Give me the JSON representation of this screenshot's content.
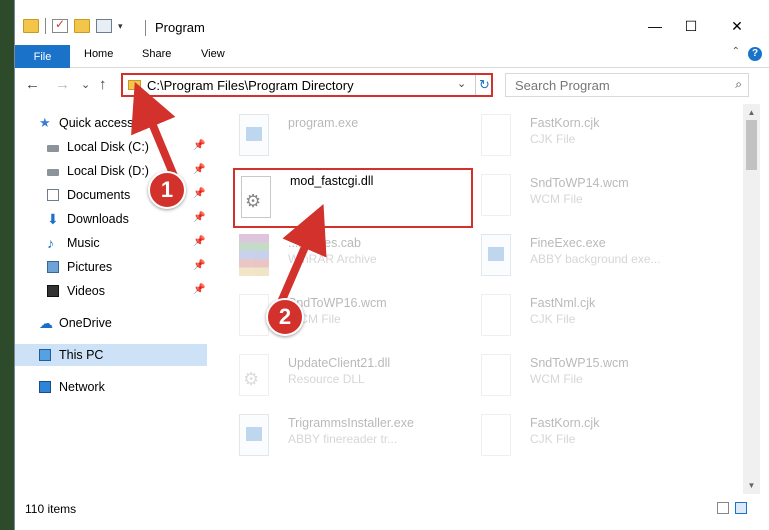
{
  "window": {
    "title": "Program",
    "controls": {
      "minimize": "—",
      "maximize": "☐",
      "close": "✕"
    },
    "qat_dropdown": "▾"
  },
  "ribbon": {
    "tabs": [
      "File",
      "Home",
      "Share",
      "View"
    ],
    "collapse": "⌃",
    "help": "?"
  },
  "nav": {
    "back": "←",
    "forward": "→",
    "recent": "⌄",
    "up": "↑",
    "address": "C:\\Program Files\\Program Directory",
    "address_dropdown": "⌄",
    "refresh": "↻",
    "search_placeholder": "Search Program",
    "search_icon": "⌕"
  },
  "sidebar": {
    "items": [
      {
        "label": "Quick access",
        "icon": "star-icon"
      },
      {
        "label": "Local Disk (C:)",
        "icon": "drive-icon",
        "pinned": true
      },
      {
        "label": "Local Disk (D:)",
        "icon": "drive-icon",
        "pinned": true
      },
      {
        "label": "Documents",
        "icon": "documents-icon",
        "pinned": true
      },
      {
        "label": "Downloads",
        "icon": "download-icon",
        "pinned": true
      },
      {
        "label": "Music",
        "icon": "music-icon",
        "pinned": true
      },
      {
        "label": "Pictures",
        "icon": "pictures-icon",
        "pinned": true
      },
      {
        "label": "Videos",
        "icon": "videos-icon",
        "pinned": true
      },
      {
        "label": "OneDrive",
        "icon": "cloud-icon"
      },
      {
        "label": "This PC",
        "icon": "computer-icon",
        "selected": true
      },
      {
        "label": "Network",
        "icon": "network-icon"
      }
    ],
    "pin_glyph": "📌"
  },
  "files": [
    {
      "name": "program.exe",
      "type": "",
      "icon": "program-exe-icon"
    },
    {
      "name": "FastKorn.cjk",
      "type": "CJK File",
      "icon": "blank-file-icon"
    },
    {
      "name": "mod_fastcgi.dll",
      "type": "",
      "icon": "dll-gear-icon"
    },
    {
      "name": "SndToWP14.wcm",
      "type": "WCM File",
      "icon": "blank-file-icon"
    },
    {
      "name": "...ificates.cab",
      "type": "WinRAR Archive",
      "icon": "winrar-icon"
    },
    {
      "name": "FineExec.exe",
      "type": "ABBY background exe...",
      "icon": "exe-icon"
    },
    {
      "name": "SndToWP16.wcm",
      "type": "WCM File",
      "icon": "blank-file-icon"
    },
    {
      "name": "FastNml.cjk",
      "type": "CJK File",
      "icon": "blank-file-icon"
    },
    {
      "name": "UpdateClient21.dll",
      "type": "Resource DLL",
      "icon": "dll-gear-icon"
    },
    {
      "name": "SndToWP15.wcm",
      "type": "WCM File",
      "icon": "blank-file-icon"
    },
    {
      "name": "TrigrammsInstaller.exe",
      "type": "ABBY finereader tr...",
      "icon": "exe-icon"
    },
    {
      "name": "FastKorn.cjk",
      "type": "CJK File",
      "icon": "blank-file-icon"
    }
  ],
  "status": {
    "count": "110 items"
  },
  "markers": {
    "one": "1",
    "two": "2"
  },
  "colors": {
    "accent": "#1a73c9",
    "highlight": "#d2312c",
    "selected_bg": "#cde2f7"
  }
}
